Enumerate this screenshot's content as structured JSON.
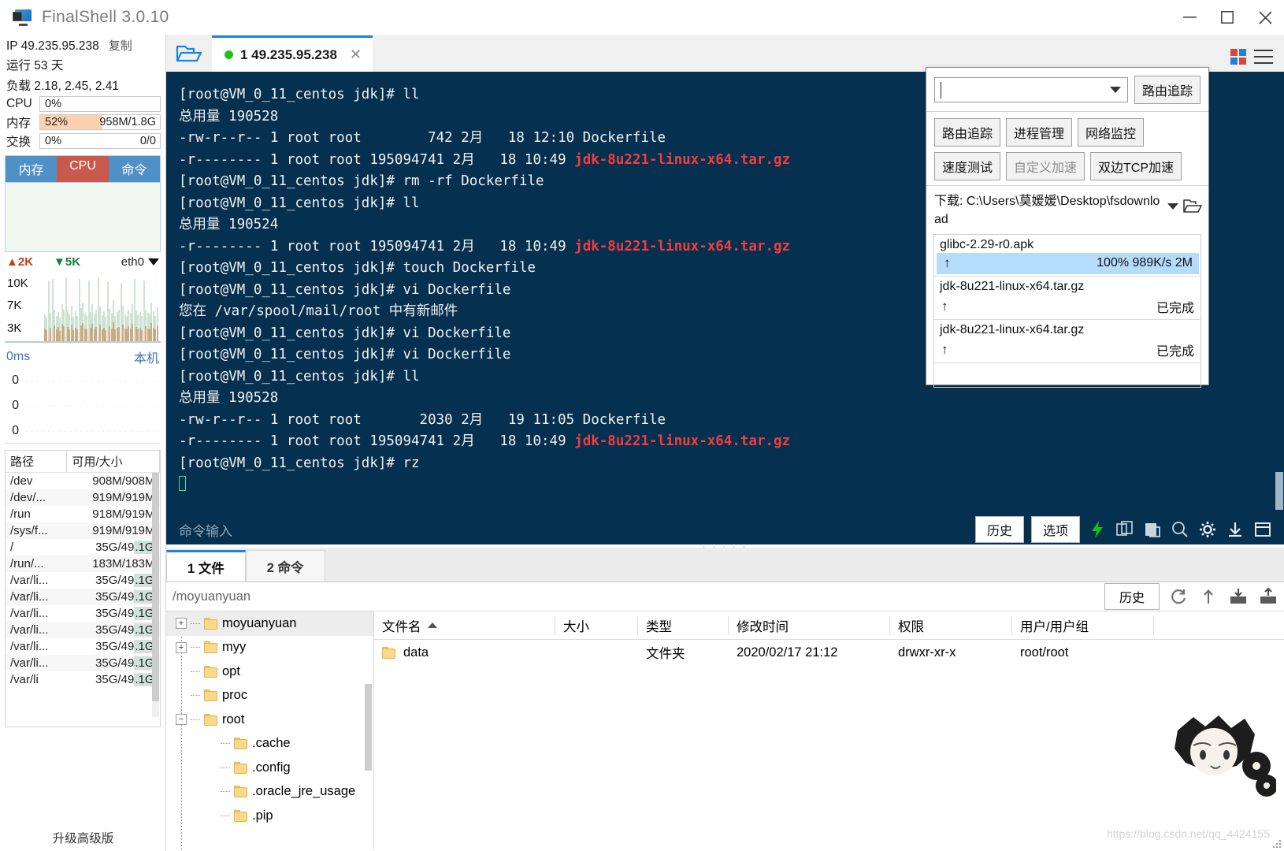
{
  "window": {
    "title": "FinalShell 3.0.10",
    "minimize": "—",
    "maximize": "□",
    "close": "✕"
  },
  "sidebar": {
    "ip_label": "IP 49.235.95.238",
    "copy_label": "复制",
    "uptime": "运行 53 天",
    "load": "负载 2.18, 2.45, 2.41",
    "meters": [
      {
        "name": "CPU",
        "percent_text": "0%",
        "right_text": "",
        "fill_pct": 0
      },
      {
        "name": "内存",
        "percent_text": "52%",
        "right_text": "958M/1.8G",
        "fill_pct": 52
      },
      {
        "name": "交换",
        "percent_text": "0%",
        "right_text": "0/0",
        "fill_pct": 0
      }
    ],
    "graph_tabs": [
      {
        "label": "内存",
        "active": true
      },
      {
        "label": "CPU",
        "active": false
      },
      {
        "label": "命令",
        "active": false
      }
    ],
    "net": {
      "up": "2K",
      "down": "5K",
      "interface": "eth0",
      "axis": [
        "10K",
        "7K",
        "3K"
      ]
    },
    "ping": {
      "latency": "0ms",
      "host": "本机",
      "values": [
        "0",
        "0",
        "0"
      ]
    },
    "disk": {
      "headers": [
        "路径",
        "可用/大小"
      ],
      "rows": [
        {
          "path": "/dev",
          "size": "908M/908M",
          "hl": ""
        },
        {
          "path": "/dev/...",
          "size": "919M/919M",
          "hl": ""
        },
        {
          "path": "/run",
          "size": "918M/919M",
          "hl": ""
        },
        {
          "path": "/sys/f...",
          "size": "919M/919M",
          "hl": ""
        },
        {
          "path": "/",
          "size": "35G/49.1G",
          "hl": ".1G"
        },
        {
          "path": "/run/...",
          "size": "183M/183M",
          "hl": ""
        },
        {
          "path": "/var/li...",
          "size": "35G/49.1G",
          "hl": ".1G"
        },
        {
          "path": "/var/li...",
          "size": "35G/49.1G",
          "hl": ".1G"
        },
        {
          "path": "/var/li...",
          "size": "35G/49.1G",
          "hl": ".1G"
        },
        {
          "path": "/var/li...",
          "size": "35G/49.1G",
          "hl": ".1G"
        },
        {
          "path": "/var/li...",
          "size": "35G/49.1G",
          "hl": ".1G"
        },
        {
          "path": "/var/li...",
          "size": "35G/49.1G",
          "hl": ".1G"
        },
        {
          "path": "/var/li",
          "size": "35G/49.1G",
          "hl": ".1G"
        }
      ]
    },
    "upgrade_label": "升级高级版"
  },
  "tabbar": {
    "folder_icon": "open-folder-icon",
    "tab_label": "1 49.235.95.238",
    "tab_close": "✕"
  },
  "terminal": {
    "lines": [
      {
        "text": "[root@VM_0_11_centos jdk]# ll",
        "red": ""
      },
      {
        "text": "总用量 190528",
        "red": ""
      },
      {
        "text": "-rw-r--r-- 1 root root        742 2月   18 12:10 Dockerfile",
        "red": ""
      },
      {
        "text": "-r-------- 1 root root 195094741 2月   18 10:49 ",
        "red": "jdk-8u221-linux-x64.tar.gz"
      },
      {
        "text": "[root@VM_0_11_centos jdk]# rm -rf Dockerfile",
        "red": ""
      },
      {
        "text": "[root@VM_0_11_centos jdk]# ll",
        "red": ""
      },
      {
        "text": "总用量 190524",
        "red": ""
      },
      {
        "text": "-r-------- 1 root root 195094741 2月   18 10:49 ",
        "red": "jdk-8u221-linux-x64.tar.gz"
      },
      {
        "text": "[root@VM_0_11_centos jdk]# touch Dockerfile",
        "red": ""
      },
      {
        "text": "[root@VM_0_11_centos jdk]# vi Dockerfile",
        "red": ""
      },
      {
        "text": "您在 /var/spool/mail/root 中有新邮件",
        "red": ""
      },
      {
        "text": "[root@VM_0_11_centos jdk]# vi Dockerfile",
        "red": ""
      },
      {
        "text": "[root@VM_0_11_centos jdk]# vi Dockerfile",
        "red": ""
      },
      {
        "text": "[root@VM_0_11_centos jdk]# ll",
        "red": ""
      },
      {
        "text": "总用量 190528",
        "red": ""
      },
      {
        "text": "-rw-r--r-- 1 root root       2030 2月   19 11:05 Dockerfile",
        "red": ""
      },
      {
        "text": "-r-------- 1 root root 195094741 2月   18 10:49 ",
        "red": "jdk-8u221-linux-x64.tar.gz"
      },
      {
        "text": "[root@VM_0_11_centos jdk]# rz",
        "red": ""
      }
    ],
    "input_placeholder": "命令输入",
    "history_button": "历史",
    "options_button": "选项",
    "icons": [
      "lightning-icon",
      "copy-icon",
      "paste-icon",
      "search-icon",
      "gear-icon",
      "download-icon",
      "window-icon"
    ]
  },
  "netpanel": {
    "address_value": "",
    "trace_button_top": "路由追踪",
    "buttons_row1": [
      "路由追踪",
      "进程管理",
      "网络监控",
      "速度测试"
    ],
    "buttons_row2": [
      "自定义加速",
      "双边TCP加速"
    ],
    "download_path": "下载: C:\\Users\\莫媛媛\\Desktop\\fsdownload",
    "downloads": [
      {
        "name": "glibc-2.29-r0.apk",
        "status": "100% 989K/s 2M",
        "selected": true
      },
      {
        "name": "jdk-8u221-linux-x64.tar.gz",
        "status": "已完成",
        "selected": false
      },
      {
        "name": "jdk-8u221-linux-x64.tar.gz",
        "status": "已完成",
        "selected": false
      }
    ]
  },
  "lower": {
    "tabs": [
      {
        "label": "1 文件",
        "active": true
      },
      {
        "label": "2 命令",
        "active": false
      }
    ],
    "path": "/moyuanyuan",
    "history_button": "历史",
    "toolbar_icons": [
      "refresh-icon",
      "upload-arrow-icon",
      "download-file-icon",
      "upload-file-icon"
    ],
    "tree": [
      {
        "label": "moyuanyuan",
        "depth": 0,
        "expander": "+",
        "selected": true
      },
      {
        "label": "myy",
        "depth": 0,
        "expander": "+",
        "selected": false
      },
      {
        "label": "opt",
        "depth": 0,
        "expander": "",
        "selected": false
      },
      {
        "label": "proc",
        "depth": 0,
        "expander": "",
        "selected": false
      },
      {
        "label": "root",
        "depth": 0,
        "expander": "−",
        "selected": false
      },
      {
        "label": ".cache",
        "depth": 1,
        "expander": "",
        "selected": false
      },
      {
        "label": ".config",
        "depth": 1,
        "expander": "",
        "selected": false
      },
      {
        "label": ".oracle_jre_usage",
        "depth": 1,
        "expander": "",
        "selected": false
      },
      {
        "label": ".pip",
        "depth": 1,
        "expander": "",
        "selected": false
      }
    ],
    "columns": [
      "文件名",
      "大小",
      "类型",
      "修改时间",
      "权限",
      "用户/用户组"
    ],
    "rows": [
      {
        "name": "data",
        "size": "",
        "type": "文件夹",
        "modified": "2020/02/17 21:12",
        "perm": "drwxr-xr-x",
        "owner": "root/root"
      }
    ]
  },
  "watermark": "https://blog.csdn.net/qq_4424155",
  "colors": {
    "terminal_bg": "#06304f",
    "accent_blue": "#1a85e0",
    "red_text": "#f43c3c",
    "mem_fill": "#fbd2b0",
    "tab_blue": "#4f90c6",
    "tab_red": "#c9594b"
  }
}
